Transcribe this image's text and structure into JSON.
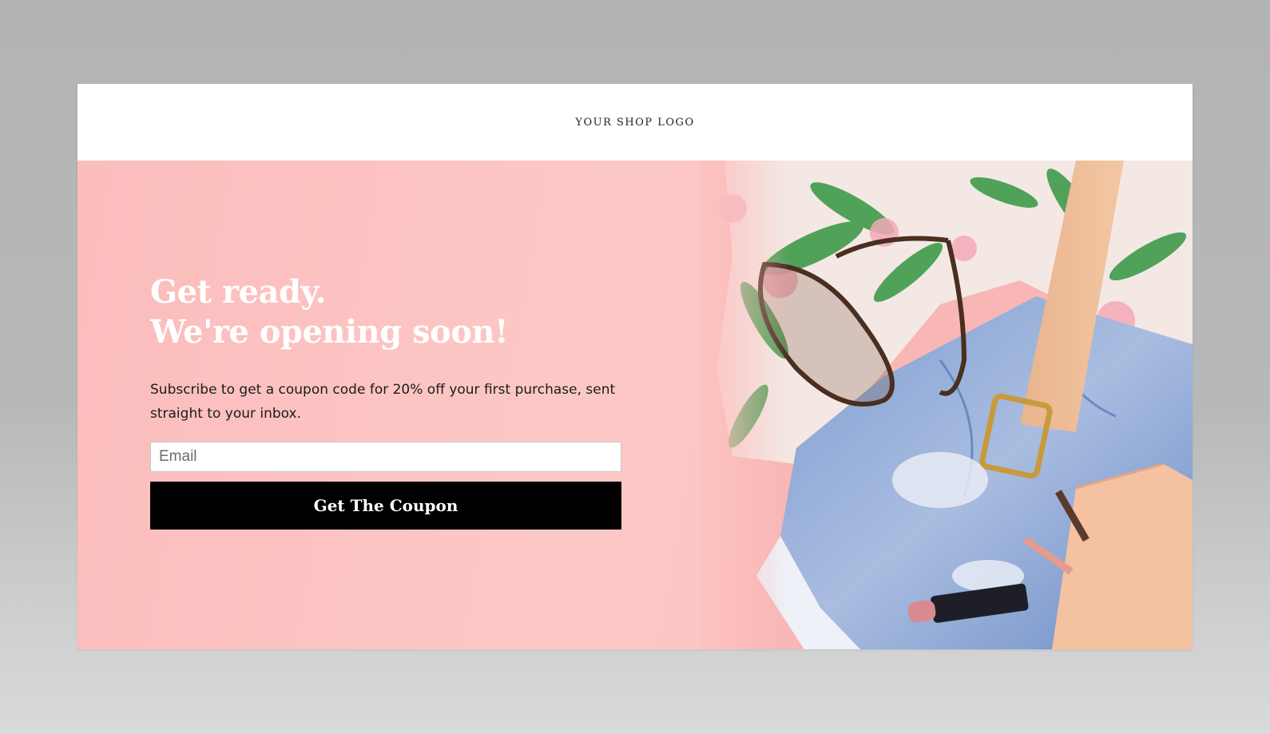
{
  "header": {
    "logo_text": "YOUR SHOP LOGO"
  },
  "hero": {
    "headline_line1": "Get ready.",
    "headline_line2": "We're opening soon!",
    "description": "Subscribe to get a coupon code for 20% off your first purchase, sent straight to your inbox.",
    "email_placeholder": "Email",
    "email_value": "",
    "button_label": "Get The Coupon",
    "image_alt": "Flat-lay of tropical print shirt, sunglasses, denim shorts, belt, lipstick and pouch"
  },
  "colors": {
    "backdrop": "#b5b6b6",
    "hero_background": "#fcc3c2",
    "headline": "#ffffff",
    "button_background": "#000000",
    "button_text": "#ffffff"
  }
}
